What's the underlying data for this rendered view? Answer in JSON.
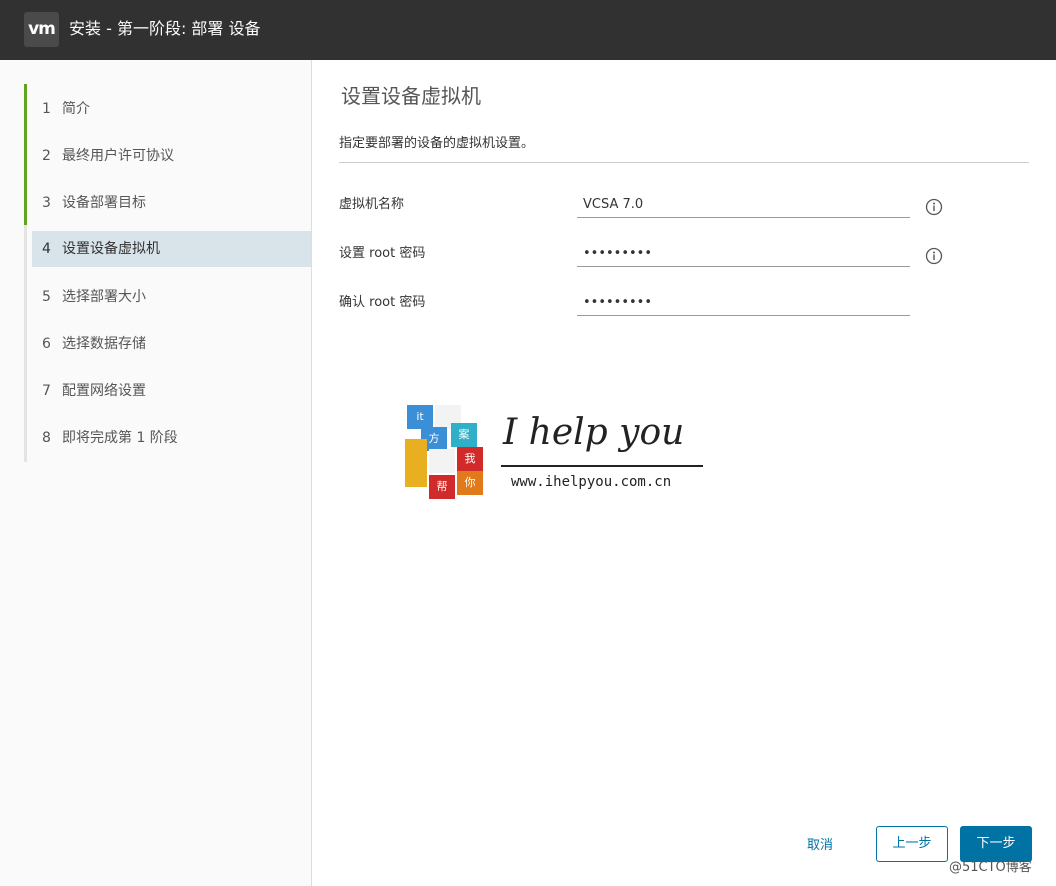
{
  "header": {
    "logo_text": "vm",
    "title": "安装 - 第一阶段: 部署 设备"
  },
  "sidebar": {
    "steps": [
      {
        "num": "1",
        "label": "简介"
      },
      {
        "num": "2",
        "label": "最终用户许可协议"
      },
      {
        "num": "3",
        "label": "设备部署目标"
      },
      {
        "num": "4",
        "label": "设置设备虚拟机"
      },
      {
        "num": "5",
        "label": "选择部署大小"
      },
      {
        "num": "6",
        "label": "选择数据存储"
      },
      {
        "num": "7",
        "label": "配置网络设置"
      },
      {
        "num": "8",
        "label": "即将完成第 1 阶段"
      }
    ],
    "active_step": 4,
    "completed_steps": 3
  },
  "main": {
    "title": "设置设备虚拟机",
    "description": "指定要部署的设备的虚拟机设置。",
    "fields": {
      "vm_name": {
        "label": "虚拟机名称",
        "value": "VCSA 7.0"
      },
      "root_password": {
        "label": "设置 root 密码",
        "value": "•••••••••"
      },
      "confirm_password": {
        "label": "确认 root 密码",
        "value": "•••••••••"
      }
    }
  },
  "watermark": {
    "cube_chars": [
      "it",
      "方",
      "案",
      "我",
      "帮",
      "你"
    ],
    "main_text": "I help you",
    "url": "www.ihelpyou.com.cn"
  },
  "footer": {
    "cancel_label": "取消",
    "back_label": "上一步",
    "next_label": "下一步",
    "credit": "@51CTO博客"
  },
  "colors": {
    "header_bg": "#313131",
    "accent": "#0072a3",
    "progress_done": "#62a420",
    "active_step_bg": "#d9e4ea"
  }
}
